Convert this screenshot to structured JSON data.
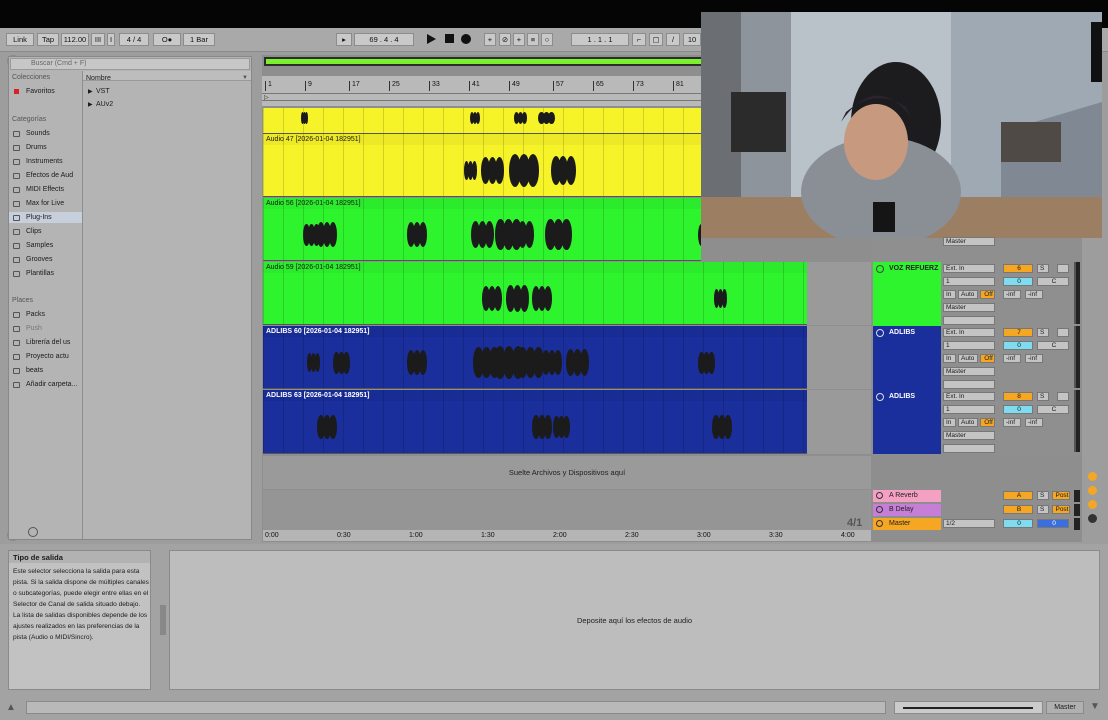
{
  "transport": {
    "link": "Link",
    "tap": "Tap",
    "tempo": "112.00",
    "signature": "4 / 4",
    "metronome": "O●",
    "quantize": "1 Bar",
    "position": "69 .   4 .   4",
    "loop_start": "1 .   1 .   1",
    "loop_length": "10"
  },
  "browser": {
    "search_placeholder": "Buscar (Cmd + F)",
    "colecciones": "Colecciones",
    "favoritos": "Favoritos",
    "categorias": "Categorías",
    "categories": [
      "Sounds",
      "Drums",
      "Instruments",
      "Efectos de Aud",
      "MIDI Effects",
      "Max for Live",
      "Plug-Ins",
      "Clips",
      "Samples",
      "Grooves",
      "Plantillas"
    ],
    "places_label": "Places",
    "places": [
      "Packs",
      "Push",
      "Librería del us",
      "Proyecto actu",
      "beats",
      "Añadir carpeta..."
    ],
    "column_header": "Nombre",
    "folders": [
      "VST",
      "AUv2"
    ]
  },
  "ruler": {
    "bars": [
      "1",
      "9",
      "17",
      "25",
      "33",
      "41",
      "49",
      "57",
      "65",
      "73",
      "81"
    ],
    "times": [
      "0:00",
      "0:30",
      "1:00",
      "1:30",
      "2:00",
      "2:30",
      "3:00",
      "3:30",
      "4:00"
    ]
  },
  "tracks": [
    {
      "label": "",
      "color": "#f7f329"
    },
    {
      "label": "Audio 47 [2026-01-04 182951]",
      "color": "#f7f329"
    },
    {
      "label": "Audio 56 [2026-01-04 182951]",
      "color": "#2ef42e"
    },
    {
      "label": "Audio 59 [2026-01-04 182951]",
      "color": "#2ef42e"
    },
    {
      "label": "ADLIBS 60 [2026-01-04 182951]",
      "color": "#1a2e9c"
    },
    {
      "label": "ADLIBS 63 [2026-01-04 182951]",
      "color": "#1a2e9c"
    }
  ],
  "mixer": {
    "master_out": "Master",
    "ext_in": "Ext. In",
    "channel_1": "1",
    "in": "In",
    "auto": "Auto",
    "off": "Off",
    "inf": "-inf",
    "center": "C",
    "solo": "S",
    "channels": [
      {
        "name": "VOZ REFUERZ",
        "number": "6",
        "vol": "0"
      },
      {
        "name": "ADLIBS",
        "number": "7",
        "vol": "0"
      },
      {
        "name": "ADLIBS",
        "number": "8",
        "vol": "0"
      }
    ],
    "returns": [
      {
        "name": "A Reverb",
        "letter": "A",
        "color": "#f3a0c2"
      },
      {
        "name": "B Delay",
        "letter": "B",
        "color": "#c77ed6"
      },
      {
        "name": "Master",
        "letter": "0",
        "color": "#f5a623"
      }
    ],
    "post": "Post",
    "master_routing": "1/2",
    "master_vol": "0",
    "master_pan": "0"
  },
  "drop_text": "Suelte Archivos y Dispositivos aquí",
  "signature_display": "4/1",
  "info": {
    "title": "Tipo de salida",
    "body": "Este selector selecciona la salida para esta pista. Si la salida dispone de múltiples canales o subcategorías, puede elegir entre ellas en el Selector de Canal de salida situado debajo.\nLa lista de salidas disponibles depende de los ajustes realizados en las preferencias de la pista (Audio o MIDI/Sincro)."
  },
  "device_drop_text": "Deposite aquí los efectos de audio",
  "status_master": "Master"
}
